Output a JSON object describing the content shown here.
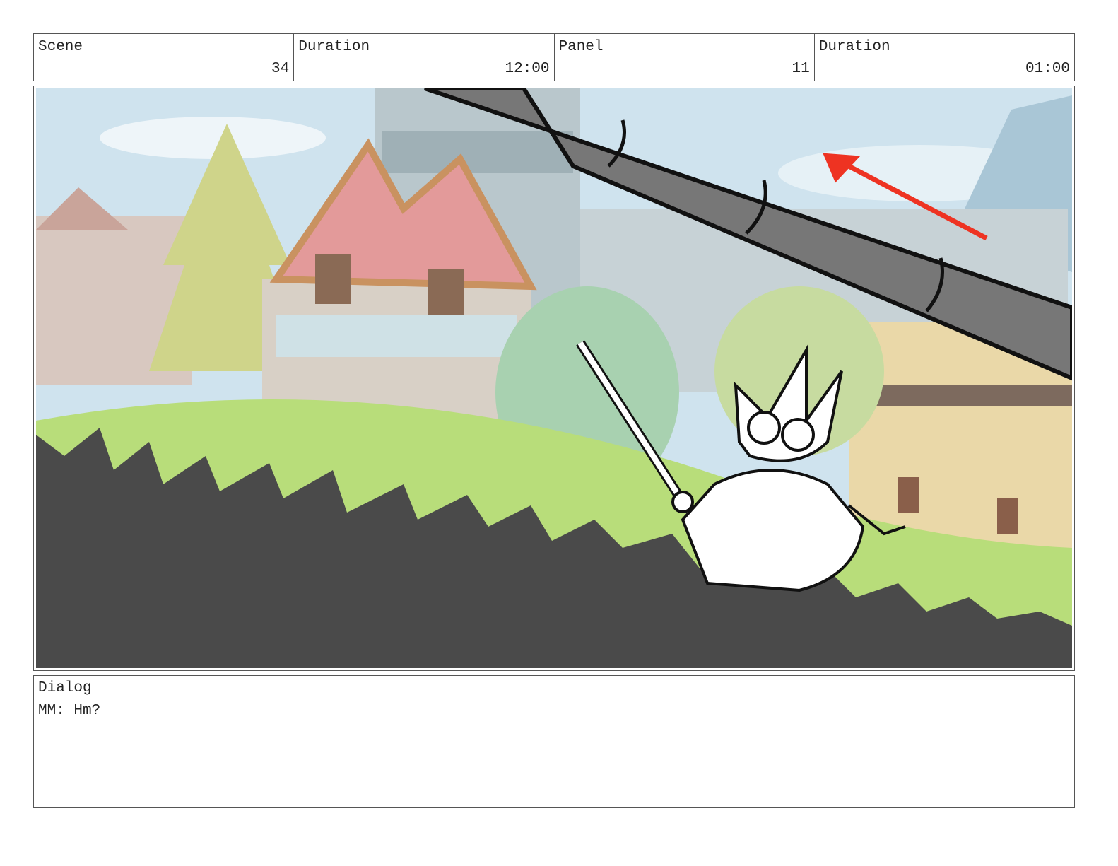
{
  "header": {
    "scene_label": "Scene",
    "scene_value": "34",
    "scene_duration_label": "Duration",
    "scene_duration_value": "12:00",
    "panel_label": "Panel",
    "panel_value": "11",
    "panel_duration_label": "Duration",
    "panel_duration_value": "01:00"
  },
  "dialog": {
    "label": "Dialog",
    "text": "MM: Hm?"
  },
  "colors": {
    "sky": "#cfe3ee",
    "grass": "#b8dd7a",
    "foreground_grass": "#4a4a4a",
    "pipe": "#777777",
    "arrow": "#ee3322",
    "roof_pink": "#e39a9a"
  }
}
